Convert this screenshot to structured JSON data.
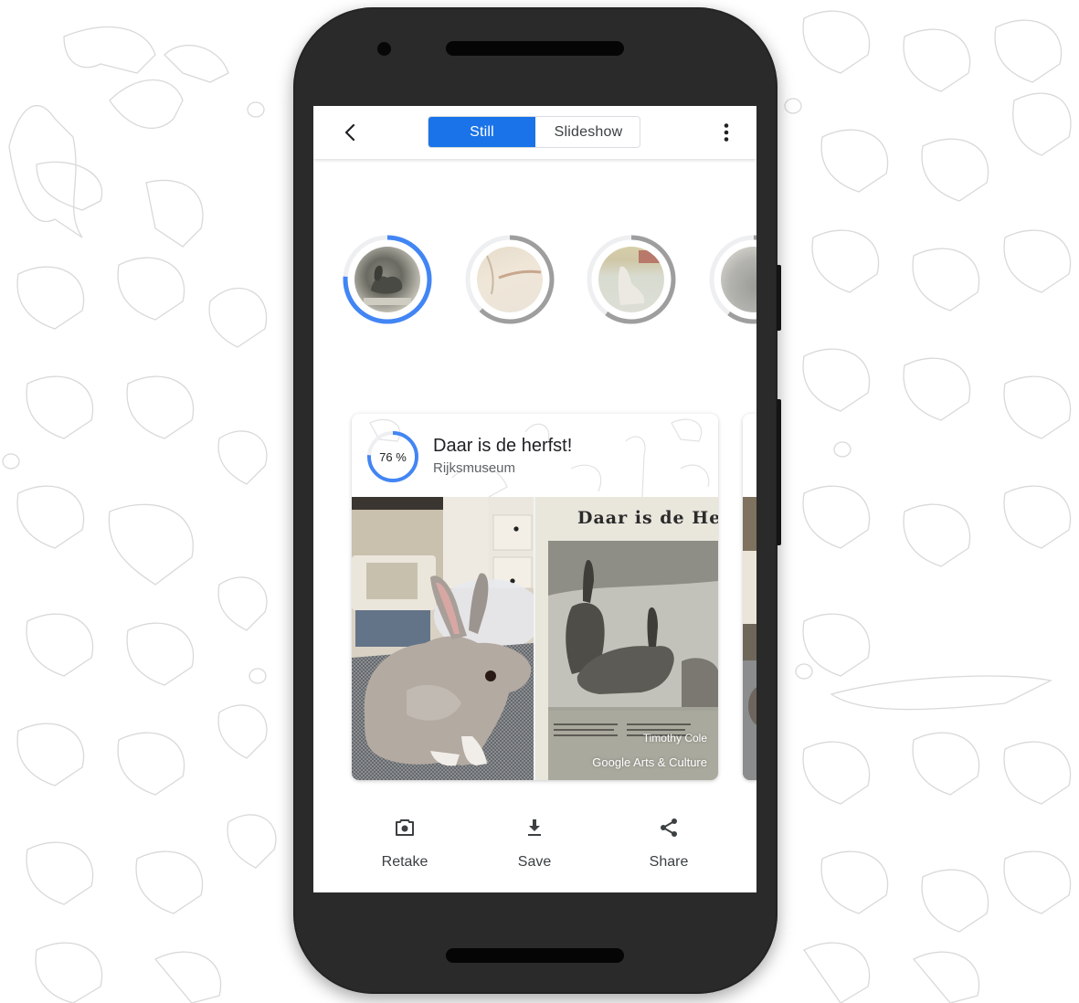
{
  "app": {
    "header": {
      "back_icon": "chevron-left-icon",
      "menu_icon": "more-vert-icon",
      "mode_toggle": {
        "options": [
          {
            "label": "Still",
            "selected": true
          },
          {
            "label": "Slideshow",
            "selected": false
          }
        ]
      }
    },
    "matches": [
      {
        "name": "match-1",
        "progress": 0.76,
        "selected": true,
        "ring_color": "#4285f4"
      },
      {
        "name": "match-2",
        "progress": 0.62,
        "selected": false,
        "ring_color": "#9e9e9e"
      },
      {
        "name": "match-3",
        "progress": 0.6,
        "selected": false,
        "ring_color": "#9e9e9e"
      },
      {
        "name": "match-4",
        "progress": 0.6,
        "selected": false,
        "ring_color": "#9e9e9e"
      }
    ],
    "result_card": {
      "match_percent_label": "76 %",
      "match_progress": 0.76,
      "title": "Daar is de herfst!",
      "subtitle": "Rijksmuseum",
      "artwork_heading": "Daar is de Her",
      "artist_credit": "Timothy Cole",
      "brand_credit": "Google Arts & Culture"
    },
    "actions": [
      {
        "label": "Retake",
        "icon": "camera-retake-icon"
      },
      {
        "label": "Save",
        "icon": "download-icon"
      },
      {
        "label": "Share",
        "icon": "share-icon"
      }
    ],
    "colors": {
      "accent": "#1a73e8",
      "ring_active": "#4285f4",
      "ring_inactive": "#9e9e9e",
      "ring_track": "#eeeff1",
      "phone_body": "#2a2a2a"
    }
  }
}
